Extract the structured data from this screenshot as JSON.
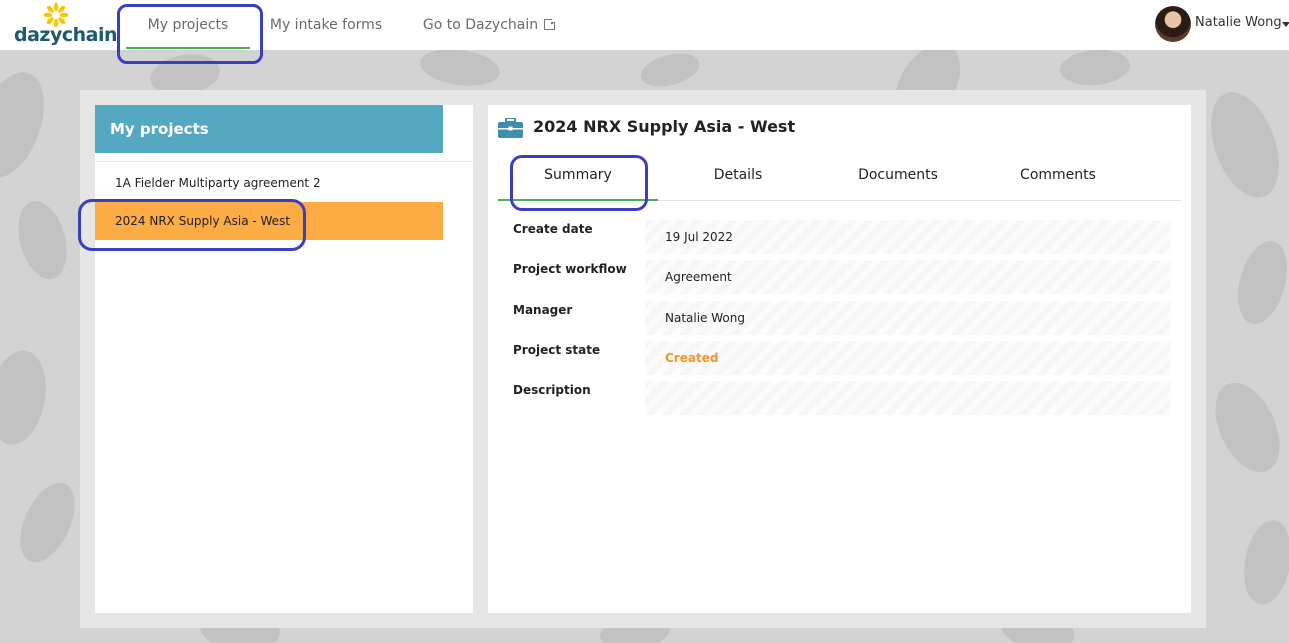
{
  "brand": {
    "logo_text": "dazychain",
    "accent": "#4caf50",
    "logo_color": "#1d5a6b",
    "flower_color": "#f5c800"
  },
  "nav": {
    "items": [
      {
        "label": "My projects",
        "active": true
      },
      {
        "label": "My intake forms",
        "active": false
      },
      {
        "label": "Go to Dazychain",
        "active": false,
        "icon": "external-link-icon"
      }
    ]
  },
  "user": {
    "name": "Natalie Wong"
  },
  "sidebar": {
    "title": "My projects",
    "header_color": "#55a8c2",
    "items": [
      {
        "label": "1A Fielder Multiparty agreement 2",
        "selected": false
      },
      {
        "label": "2024 NRX Supply Asia - West",
        "selected": true
      }
    ],
    "selected_color": "#fbac45"
  },
  "project": {
    "title": "2024 NRX Supply Asia - West",
    "icon": "briefcase-icon",
    "tabs": [
      {
        "label": "Summary",
        "active": true
      },
      {
        "label": "Details",
        "active": false
      },
      {
        "label": "Documents",
        "active": false
      },
      {
        "label": "Comments",
        "active": false
      }
    ],
    "fields": [
      {
        "label": "Create date",
        "value": "19 Jul 2022"
      },
      {
        "label": "Project workflow",
        "value": "Agreement"
      },
      {
        "label": "Manager",
        "value": "Natalie Wong"
      },
      {
        "label": "Project state",
        "value": "Created"
      },
      {
        "label": "Description",
        "value": ""
      }
    ],
    "state_color": "#f0962c"
  },
  "annotation_color": "#3b3fbf"
}
